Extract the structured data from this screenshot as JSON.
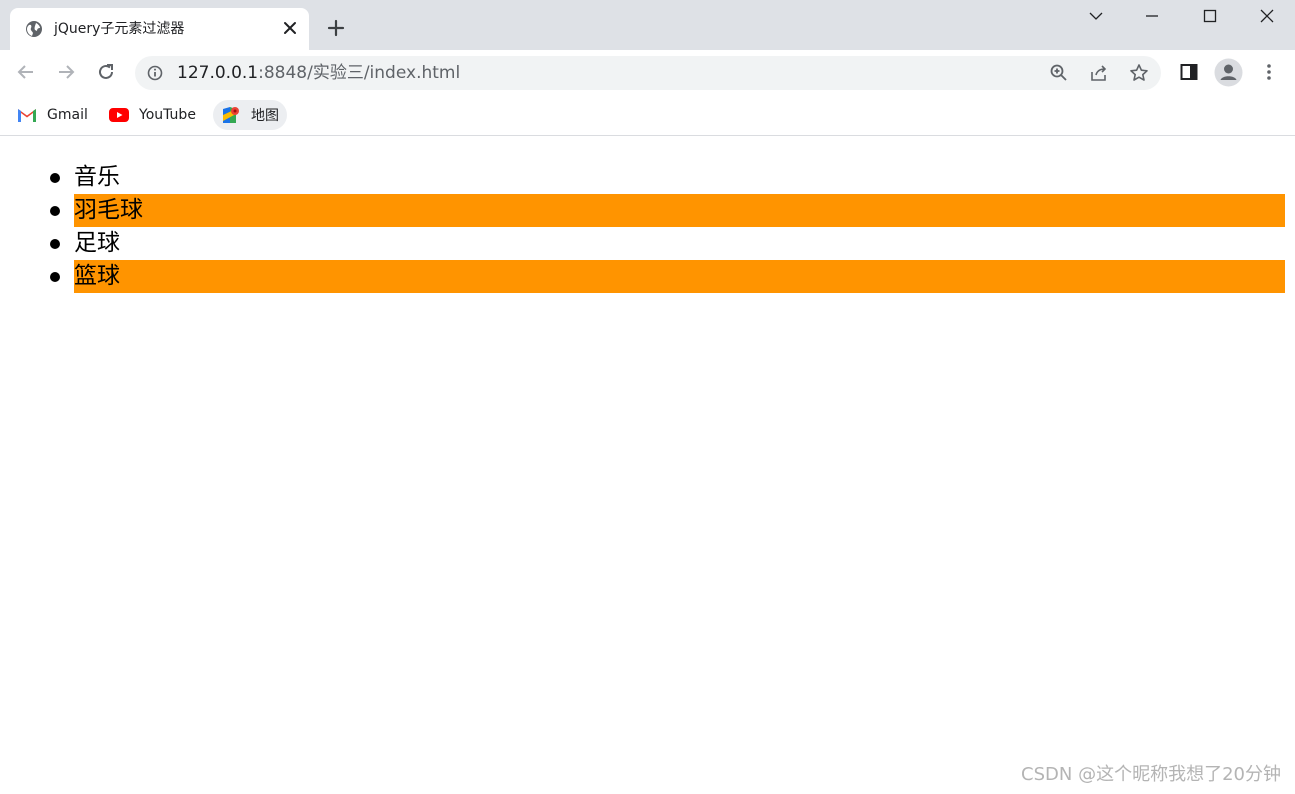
{
  "browser": {
    "tab_title": "jQuery子元素过滤器",
    "url_host": "127.0.0.1",
    "url_path": ":8848/实验三/index.html"
  },
  "bookmarks": [
    {
      "label": "Gmail",
      "icon": "gmail-icon"
    },
    {
      "label": "YouTube",
      "icon": "youtube-icon"
    },
    {
      "label": "地图",
      "icon": "maps-icon"
    }
  ],
  "page": {
    "items": [
      {
        "label": "音乐",
        "highlighted": false
      },
      {
        "label": "羽毛球",
        "highlighted": true
      },
      {
        "label": "足球",
        "highlighted": false
      },
      {
        "label": "篮球",
        "highlighted": true
      }
    ],
    "highlight_color": "#ff9400"
  },
  "watermark": "CSDN @这个昵称我想了20分钟"
}
